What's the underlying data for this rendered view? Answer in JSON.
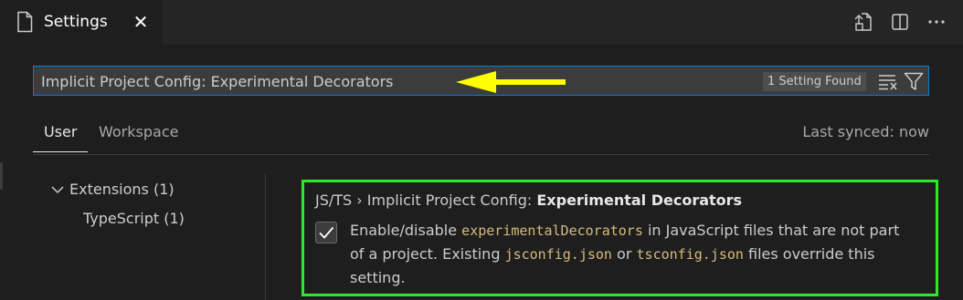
{
  "editor_tab": {
    "title": "Settings",
    "close_glyph": "✕",
    "icon": "file-icon"
  },
  "tab_actions": [
    {
      "name": "open-settings-json-icon"
    },
    {
      "name": "split-editor-icon"
    },
    {
      "name": "more-actions-icon"
    }
  ],
  "search": {
    "query": "Implicit Project Config: Experimental Decorators",
    "result_count": "1 Setting Found",
    "annotation_arrow_color": "#ffff00"
  },
  "scope_tabs": {
    "user": "User",
    "workspace": "Workspace",
    "last_synced": "Last synced: now"
  },
  "toc": {
    "extensions": "Extensions (1)",
    "typescript": "TypeScript (1)"
  },
  "setting": {
    "breadcrumb": "JS/TS › Implicit Project Config: ",
    "name": "Experimental Decorators",
    "checked": true,
    "desc_1": "Enable/disable ",
    "code_1": "experimentalDecorators",
    "desc_2": " in JavaScript files that are not part of a project. Existing ",
    "code_2": "jsconfig.json",
    "desc_3": " or ",
    "code_3": "tsconfig.json",
    "desc_4": " files override this setting.",
    "highlight_border_color": "#2ee82b"
  },
  "colors": {
    "background": "#1e1e1e",
    "focus_border": "#007fd4",
    "code": "#d7ba7d"
  }
}
